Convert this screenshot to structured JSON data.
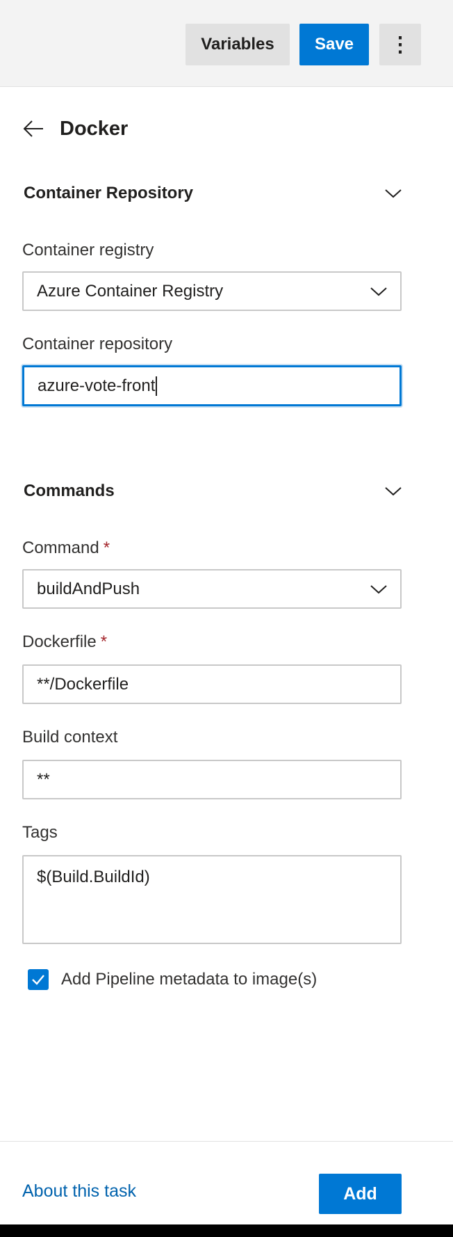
{
  "toolbar": {
    "variables_label": "Variables",
    "save_label": "Save",
    "more_label": "⋮"
  },
  "panel": {
    "title": "Docker"
  },
  "sections": {
    "container_repository": {
      "title": "Container Repository",
      "registry_label": "Container registry",
      "registry_value": "Azure Container Registry",
      "repository_label": "Container repository",
      "repository_value": "azure-vote-front"
    },
    "commands": {
      "title": "Commands",
      "command_label": "Command",
      "command_value": "buildAndPush",
      "dockerfile_label": "Dockerfile",
      "dockerfile_value": "**/Dockerfile",
      "build_context_label": "Build context",
      "build_context_value": "**",
      "tags_label": "Tags",
      "tags_value": "$(Build.BuildId)",
      "required_marker": "*"
    }
  },
  "options": {
    "add_metadata_label": "Add Pipeline metadata to image(s)",
    "add_metadata_checked": true
  },
  "footer": {
    "about_link": "About this task",
    "add_label": "Add"
  },
  "colors": {
    "accent": "#0078d4",
    "required": "#a4262c",
    "link": "#0062ad"
  },
  "icons": {
    "back": "arrow-left-icon",
    "chevron": "chevron-down-icon",
    "check": "checkmark-icon",
    "more": "more-vertical-icon"
  }
}
